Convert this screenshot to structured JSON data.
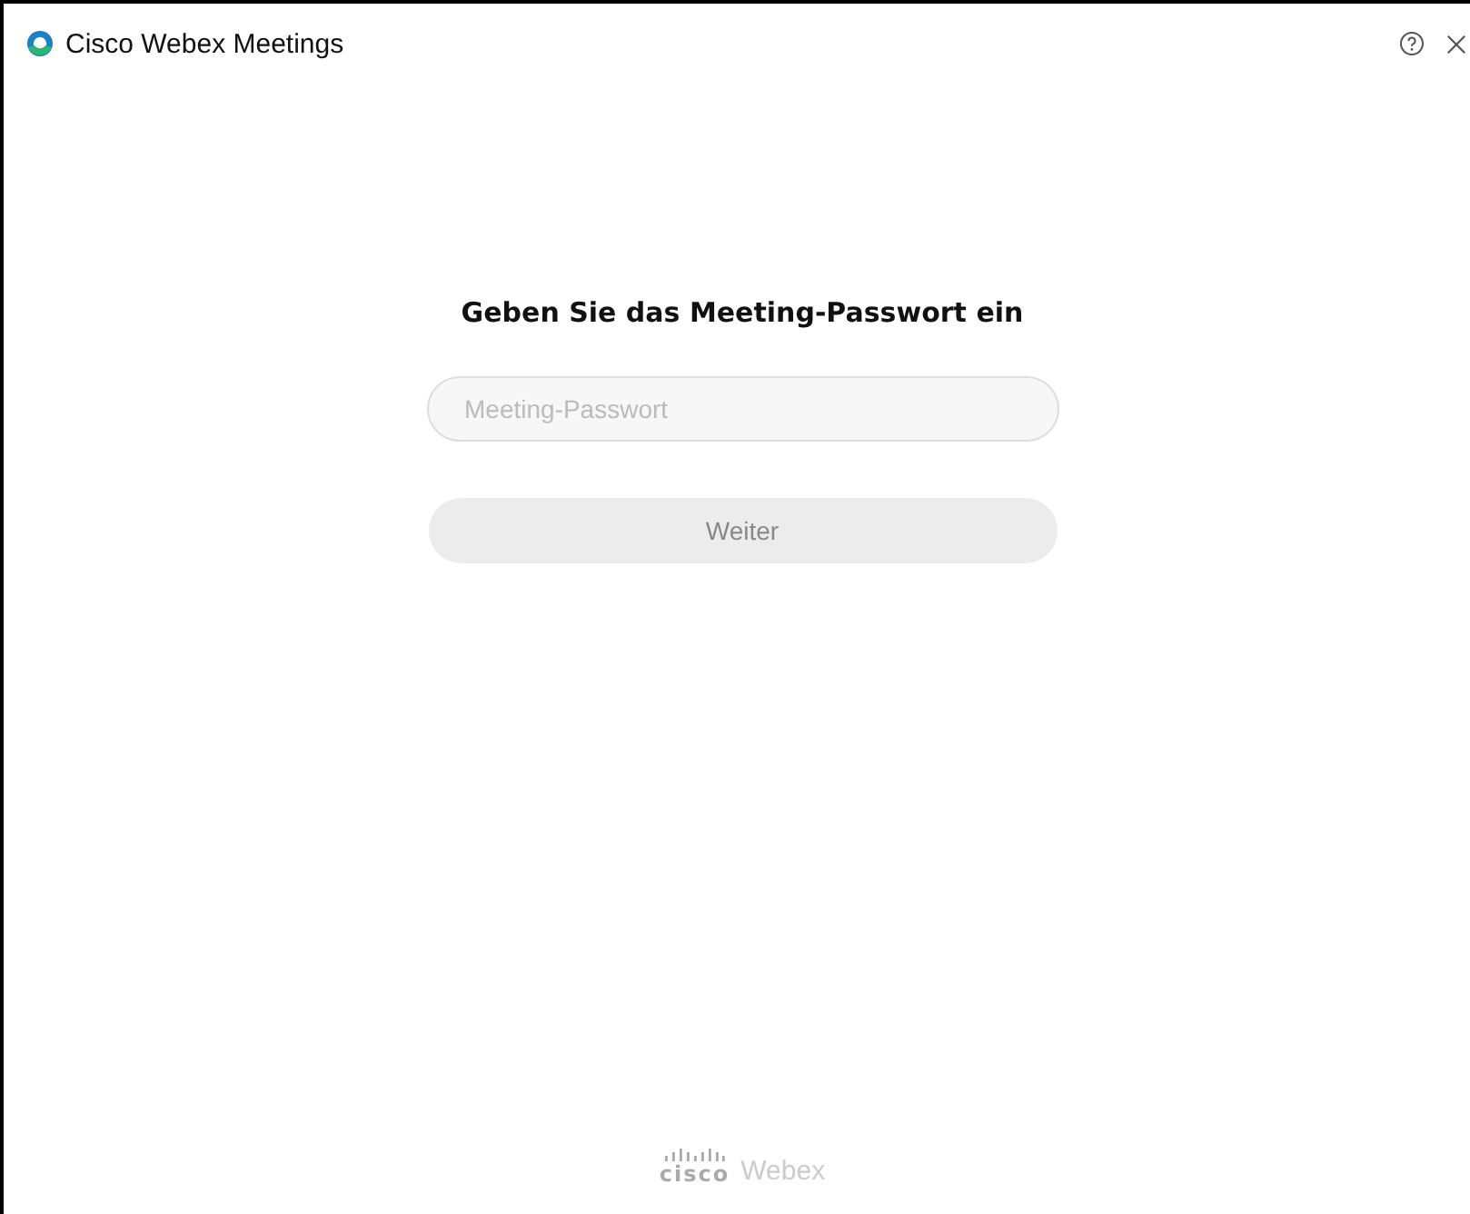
{
  "window": {
    "title": "Cisco Webex Meetings"
  },
  "dialog": {
    "heading": "Geben Sie das Meeting-Passwort ein",
    "password_field": {
      "placeholder": "Meeting-Passwort"
    },
    "continue_button": {
      "label": "Weiter",
      "disabled": true
    }
  },
  "footer": {
    "brand": "cisco",
    "product": "Webex"
  }
}
